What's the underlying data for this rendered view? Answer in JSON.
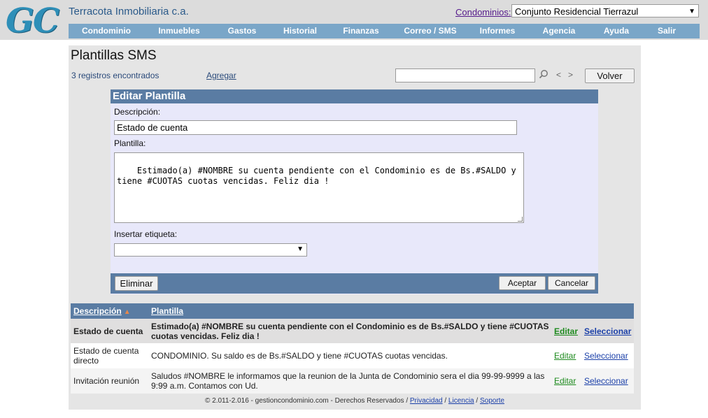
{
  "header": {
    "logo": "GC",
    "company": "Terracota Inmobiliaria c.a.",
    "condo_label": "Condominios:",
    "condo_selected": "Conjunto Residencial Tierrazul"
  },
  "menu": [
    "Condominio",
    "Inmuebles",
    "Gastos",
    "Historial",
    "Finanzas",
    "Correo / SMS",
    "Informes",
    "Agencia",
    "Ayuda",
    "Salir"
  ],
  "page": {
    "title": "Plantillas SMS",
    "records": "3 registros encontrados",
    "add_link": "Agregar",
    "search_value": "",
    "prev": "<",
    "next": ">",
    "back_button": "Volver"
  },
  "form": {
    "header": "Editar Plantilla",
    "desc_label": "Descripción:",
    "desc_value": "Estado de cuenta",
    "tpl_label": "Plantilla:",
    "tpl_value": "Estimado(a) #NOMBRE su cuenta pendiente con el Condominio es de Bs.#SALDO y\ntiene #CUOTAS cuotas vencidas. Feliz dia !",
    "tag_label": "Insertar etiqueta:",
    "tag_value": "",
    "delete_button": "Eliminar",
    "accept_button": "Aceptar",
    "cancel_button": "Cancelar"
  },
  "table": {
    "headers": [
      "Descripción",
      "Plantilla"
    ],
    "rows": [
      {
        "desc": "Estado de cuenta",
        "tpl": "Estimado(a) #NOMBRE su cuenta pendiente con el Condominio es de Bs.#SALDO y tiene #CUOTAS cuotas vencidas. Feliz dia !",
        "edit": "Editar",
        "select": "Seleccionar"
      },
      {
        "desc": "Estado de cuenta directo",
        "tpl": "CONDOMINIO. Su saldo es de Bs.#SALDO y tiene #CUOTAS cuotas vencidas.",
        "edit": "Editar",
        "select": "Seleccionar"
      },
      {
        "desc": "Invitación reunión",
        "tpl": "Saludos #NOMBRE le informamos que la reunion de la Junta de Condominio sera el dia 99-99-9999 a las 9:99 a.m. Contamos con Ud.",
        "edit": "Editar",
        "select": "Seleccionar"
      }
    ]
  },
  "footer": {
    "copyright": "© 2.011-2.016 - gestioncondominio.com - Derechos Reservados /",
    "privacy": "Privacidad",
    "license": "Licencia",
    "support": "Soporte",
    "sep": "/"
  }
}
